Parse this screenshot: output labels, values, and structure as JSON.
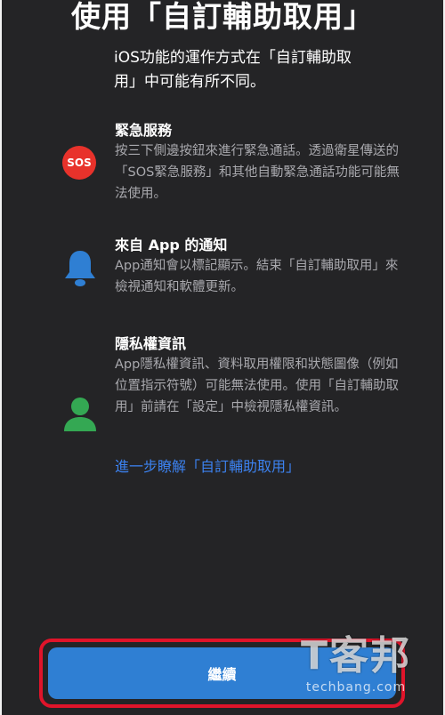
{
  "page": {
    "title": "使用「自訂輔助取用」",
    "subtitle": "iOS功能的運作方式在「自訂輔助取用」中可能有所不同。"
  },
  "features": [
    {
      "icon": "sos-icon",
      "icon_label": "SOS",
      "icon_color": "#e8322b",
      "title": "緊急服務",
      "description": "按三下側邊按鈕來進行緊急通話。透過衛星傳送的「SOS緊急服務」和其他自動緊急通話功能可能無法使用。"
    },
    {
      "icon": "bell-icon",
      "icon_color": "#2f7fd3",
      "title": "來自 App 的通知",
      "description": "App通知會以標記顯示。結束「自訂輔助取用」來檢視通知和軟體更新。"
    },
    {
      "icon": "person-icon",
      "icon_color": "#34a853",
      "title": "隱私權資訊",
      "description": "App隱私權資訊、資料取用權限和狀態圖像（例如位置指示符號）可能無法使用。使用「自訂輔助取用」前請在「設定」中檢視隱私權資訊。"
    }
  ],
  "learn_more_link": "進一步瞭解「自訂輔助取用」",
  "continue_button": "繼續",
  "watermark": {
    "mark": "T客邦",
    "text": "techbang.com"
  },
  "colors": {
    "background": "#242426",
    "accent_blue": "#2f7fd3",
    "link_blue": "#3c82f0",
    "highlight_red": "#e0142a"
  }
}
